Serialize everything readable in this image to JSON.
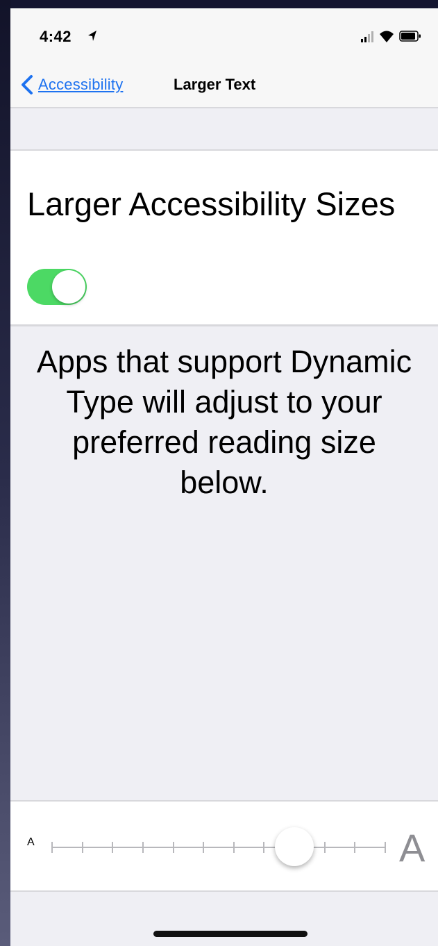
{
  "status_bar": {
    "time": "4:42",
    "icons": [
      "location-icon",
      "signal-icon",
      "wifi-icon",
      "battery-icon"
    ]
  },
  "nav": {
    "back_label": "Accessibility",
    "title": "Larger Text"
  },
  "larger_sizes": {
    "label": "Larger Accessibility Sizes",
    "toggle_on": true
  },
  "description": "Apps that support Dynamic Type will adjust to your preferred reading size below.",
  "slider": {
    "min_label": "A",
    "max_label": "A",
    "steps": 12,
    "value_index": 8
  },
  "colors": {
    "accent": "#1d72f0",
    "toggle_on": "#4cd964",
    "background": "#efeff4"
  }
}
